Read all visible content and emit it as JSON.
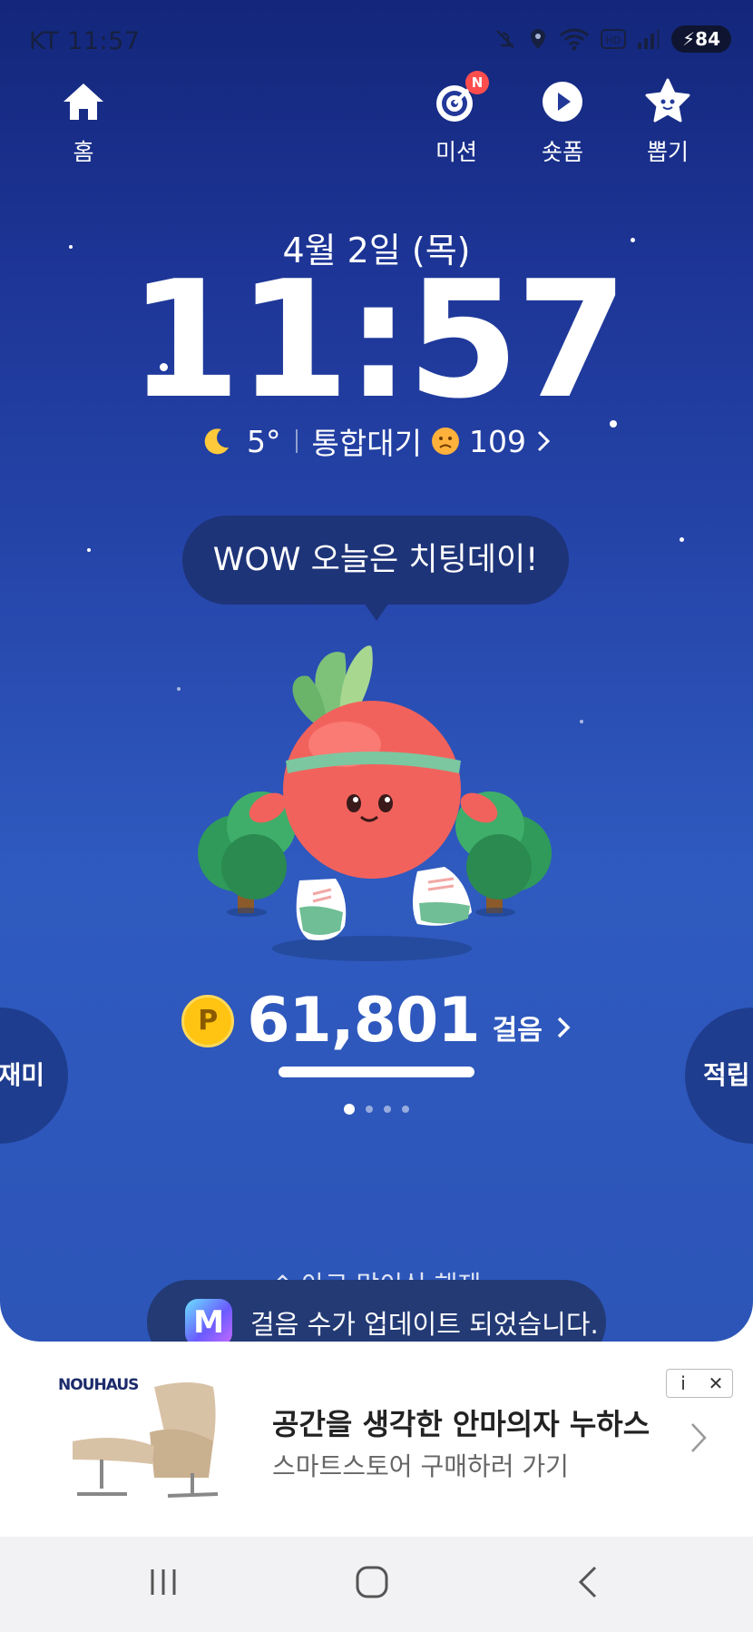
{
  "status_bar": {
    "carrier_time": "KT 11:57",
    "battery": "84"
  },
  "nav": {
    "home": "홈",
    "mission": "미션",
    "mission_badge": "N",
    "shorts": "숏폼",
    "draw": "뽑기"
  },
  "date": "4월 2일 (목)",
  "time": "11:57",
  "weather": {
    "temp": "5°",
    "air_label": "통합대기",
    "air_value": "109"
  },
  "bubble": "WOW 오늘은 치팅데이!",
  "steps": {
    "coin": "P",
    "count": "61,801",
    "unit": "걸음"
  },
  "side": {
    "left": "재미",
    "right": "적립"
  },
  "hint": "⌃ 아코 맘이식 해제",
  "toast": {
    "logo": "M",
    "message": "걸음 수가 업데이트 되었습니다."
  },
  "ad": {
    "brand": "NOUHAUS",
    "title": "공간을 생각한 안마의자 누하스",
    "subtitle": "스마트스토어 구매하러 가기",
    "info": "i",
    "close": "✕"
  },
  "colors": {
    "hero_top": "#13267a",
    "hero_bottom": "#2f5abf",
    "coin": "#ffc312",
    "radish": "#f2625c"
  }
}
